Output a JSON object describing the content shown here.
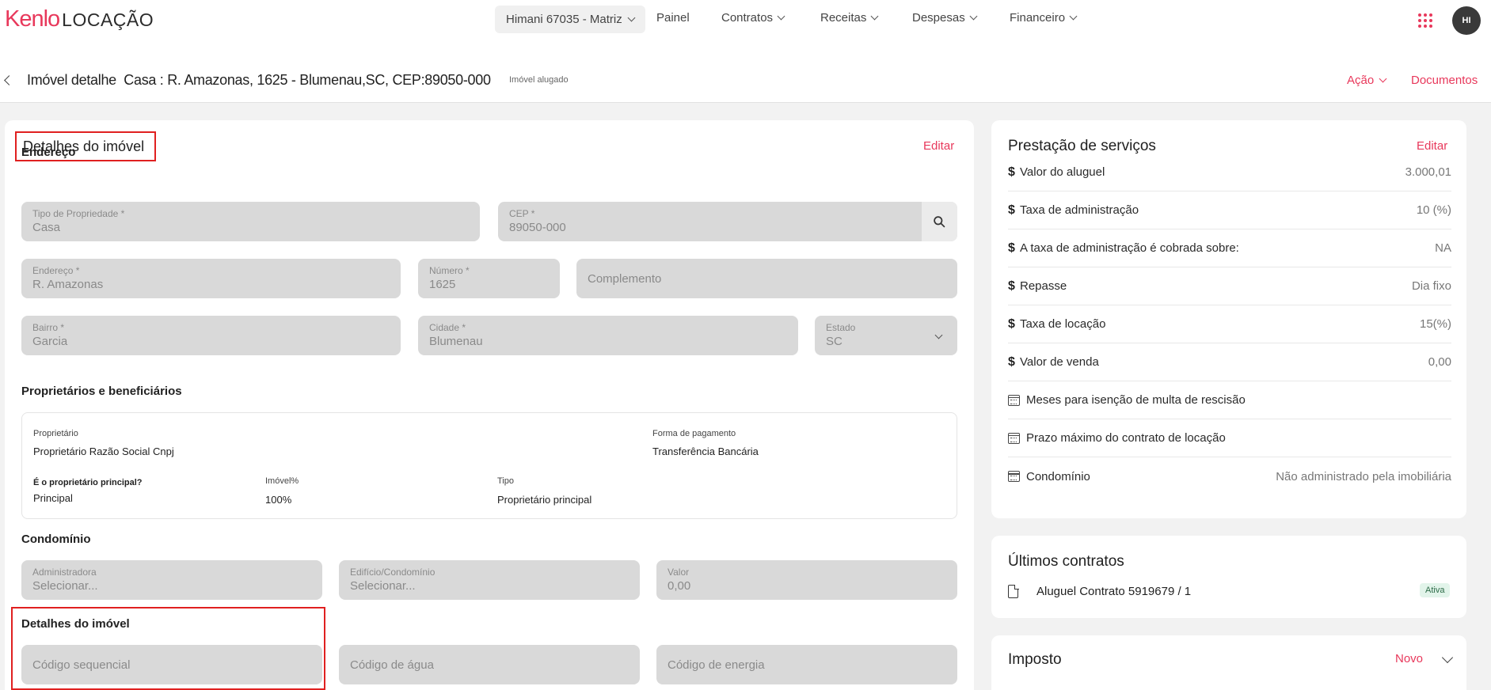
{
  "brand": {
    "name_a": "Kenlo",
    "name_b": "LOCAÇÃO",
    "color": "#e8385b"
  },
  "nav": {
    "branch": "Himani 67035 - Matriz",
    "items": [
      "Painel",
      "Contratos",
      "Receitas",
      "Despesas",
      "Financeiro"
    ],
    "avatar": "HI"
  },
  "header": {
    "title_a": "Imóvel detalhe",
    "title_b": "Casa : R. Amazonas, 1625 - Blumenau,SC, CEP:89050-000",
    "status": "Imóvel alugado",
    "action": "Ação",
    "documents": "Documentos"
  },
  "details": {
    "title": "Detalhes do imóvel",
    "edit": "Editar",
    "address_section": "Endereço",
    "tipo": {
      "label": "Tipo de Propriedade *",
      "value": "Casa"
    },
    "cep": {
      "label": "CEP *",
      "value": "89050-000"
    },
    "endereco": {
      "label": "Endereço *",
      "value": "R. Amazonas"
    },
    "numero": {
      "label": "Número *",
      "value": "1625"
    },
    "complemento": {
      "placeholder": "Complemento"
    },
    "bairro": {
      "label": "Bairro *",
      "value": "Garcia"
    },
    "cidade": {
      "label": "Cidade *",
      "value": "Blumenau"
    },
    "estado": {
      "label": "Estado",
      "value": "SC"
    },
    "owners_section": "Proprietários e beneficiários",
    "owner": {
      "proprietario_label": "Proprietário",
      "proprietario_value": "Proprietário Razão Social Cnpj",
      "pagamento_label": "Forma de pagamento",
      "pagamento_value": "Transferência Bancária",
      "principal_label": "É o proprietário principal?",
      "principal_value": "Principal",
      "imovel_label": "Imóvel%",
      "imovel_value": "100%",
      "tipo_label": "Tipo",
      "tipo_value": "Proprietário principal"
    },
    "condominio_section": "Condomínio",
    "administradora": {
      "label": "Administradora",
      "value": "Selecionar..."
    },
    "edificio": {
      "label": "Edifício/Condomínio",
      "value": "Selecionar..."
    },
    "valor": {
      "label": "Valor",
      "value": "0,00"
    },
    "details_section": "Detalhes do imóvel",
    "codigo_seq": "Código sequencial",
    "codigo_agua": "Código de água",
    "codigo_energia": "Código de energia"
  },
  "services": {
    "title": "Prestação de serviços",
    "edit": "Editar",
    "rows": [
      {
        "icon": "dollar",
        "label": "Valor do aluguel",
        "value": "3.000,01"
      },
      {
        "icon": "dollar",
        "label": "Taxa de administração",
        "value": "10 (%)"
      },
      {
        "icon": "dollar",
        "label": "A taxa de administração é cobrada sobre:",
        "value": "NA"
      },
      {
        "icon": "dollar",
        "label": "Repasse",
        "value": "Dia fixo"
      },
      {
        "icon": "dollar",
        "label": "Taxa de locação",
        "value": "15(%)"
      },
      {
        "icon": "dollar",
        "label": "Valor de venda",
        "value": "0,00"
      },
      {
        "icon": "calendar",
        "label": "Meses para isenção de multa de rescisão",
        "value": ""
      },
      {
        "icon": "calendar",
        "label": "Prazo máximo do contrato de locação",
        "value": ""
      },
      {
        "icon": "calendar",
        "label": "Condomínio",
        "value": "Não administrado pela imobiliária"
      }
    ]
  },
  "contracts": {
    "title": "Últimos contratos",
    "item": "Aluguel Contrato 5919679 / 1",
    "badge": "Ativa"
  },
  "tax": {
    "title": "Imposto",
    "new": "Novo"
  }
}
